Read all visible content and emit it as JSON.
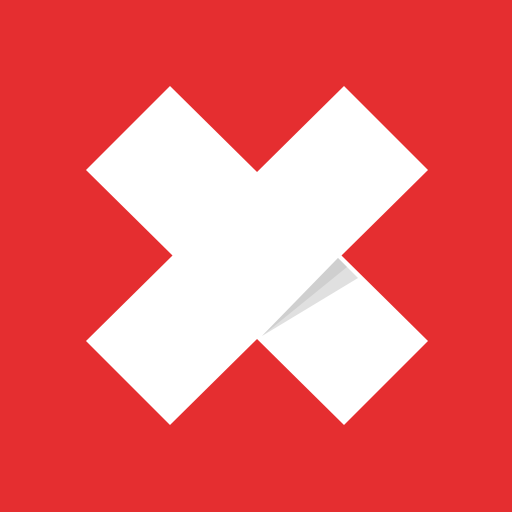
{
  "icon": {
    "name": "close-x-app-icon",
    "background_color": "#E52E30",
    "mark_color": "#FFFFFF",
    "fold_shadow_color": "#E0E0E0",
    "fold_shadow_dark_color": "#CFCFCF"
  }
}
